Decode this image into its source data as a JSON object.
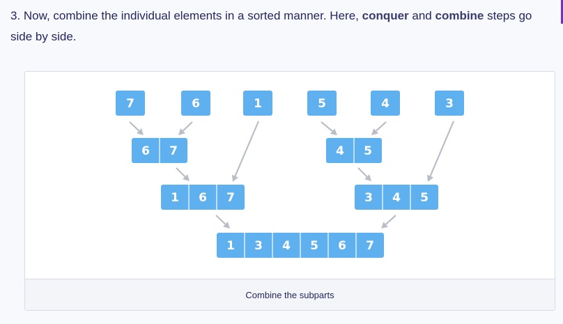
{
  "step": {
    "prefix": "3. Now, combine the individual elements in a sorted manner. Here, ",
    "bold1": "conquer",
    "mid": " and ",
    "bold2": "combine",
    "suffix": " steps go side by side."
  },
  "diagram": {
    "single_elements": [
      "7",
      "6",
      "1",
      "5",
      "4",
      "3"
    ],
    "merge_pair_left": [
      "6",
      "7"
    ],
    "merge_pair_right": [
      "4",
      "5"
    ],
    "merge_three_left": [
      "1",
      "6",
      "7"
    ],
    "merge_three_right": [
      "3",
      "4",
      "5"
    ],
    "final_merged": [
      "1",
      "3",
      "4",
      "5",
      "6",
      "7"
    ]
  },
  "caption": "Combine the subparts",
  "colors": {
    "cell": "#5fb0ef",
    "arrow": "#b9bec7",
    "accent": "#6b2fd6"
  }
}
